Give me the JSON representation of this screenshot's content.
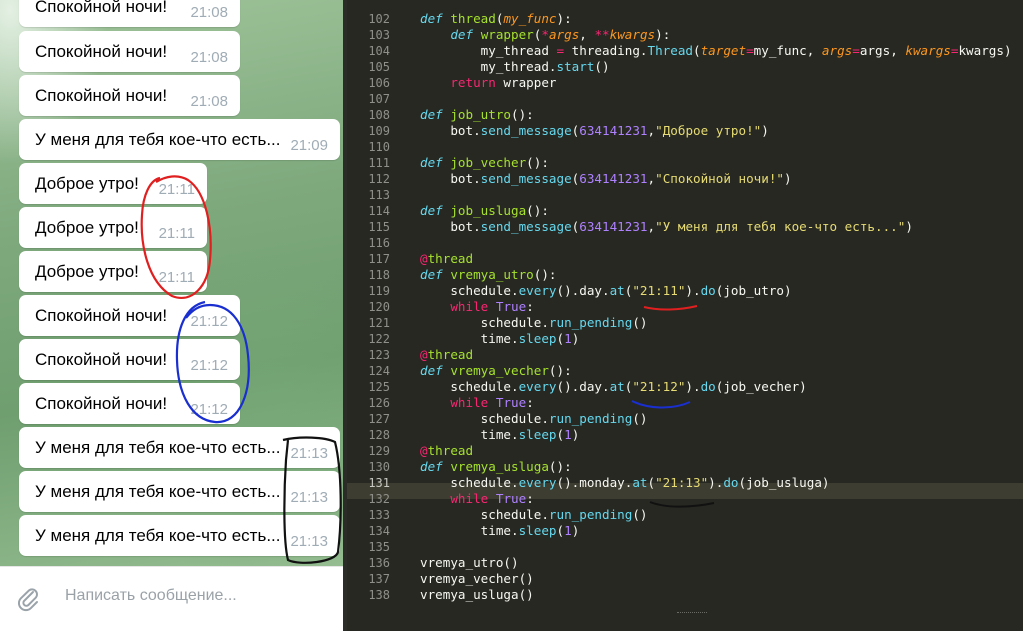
{
  "chat": {
    "messages": [
      {
        "text": "Спокойной ночи!",
        "time": "21:08"
      },
      {
        "text": "Спокойной ночи!",
        "time": "21:08"
      },
      {
        "text": "Спокойной ночи!",
        "time": "21:08"
      },
      {
        "text": "У меня для тебя кое-что есть...",
        "time": "21:09"
      },
      {
        "text": "Доброе утро!",
        "time": "21:11"
      },
      {
        "text": "Доброе утро!",
        "time": "21:11"
      },
      {
        "text": "Доброе утро!",
        "time": "21:11"
      },
      {
        "text": "Спокойной ночи!",
        "time": "21:12"
      },
      {
        "text": "Спокойной ночи!",
        "time": "21:12"
      },
      {
        "text": "Спокойной ночи!",
        "time": "21:12"
      },
      {
        "text": "У меня для тебя кое-что есть...",
        "time": "21:13"
      },
      {
        "text": "У меня для тебя кое-что есть...",
        "time": "21:13"
      },
      {
        "text": "У меня для тебя кое-что есть...",
        "time": "21:13"
      }
    ],
    "composer": {
      "placeholder": "Написать сообщение...",
      "attach_icon": "paperclip-icon"
    }
  },
  "editor": {
    "line_numbers": [
      "102",
      "103",
      "104",
      "105",
      "106",
      "107",
      "108",
      "109",
      "110",
      "111",
      "112",
      "113",
      "114",
      "115",
      "116",
      "117",
      "118",
      "119",
      "120",
      "121",
      "122",
      "123",
      "124",
      "125",
      "126",
      "127",
      "128",
      "129",
      "130",
      "131",
      "132",
      "133",
      "134",
      "135",
      "136",
      "137",
      "138"
    ],
    "current_line": "131",
    "strings": {
      "time_utro": "\"21:11\"",
      "time_vecher": "\"21:12\"",
      "time_usluga": "\"21:13\"",
      "msg_utro": "\"Доброе утро!\"",
      "msg_vecher": "\"Спокойной ночи!\"",
      "msg_usluga": "\"У меня для тебя кое-что есть...\"",
      "chat_id": "634141231"
    },
    "colors": {
      "background": "#272822",
      "keyword": "#f92672",
      "function": "#a6e22e",
      "string": "#e6db74",
      "number": "#ae81ff",
      "builtin": "#66d9ef",
      "param": "#fd971f"
    }
  },
  "annotations": {
    "red_circle_color": "#e02020",
    "blue_circle_color": "#1a2fd0",
    "black_circle_color": "#111111"
  }
}
